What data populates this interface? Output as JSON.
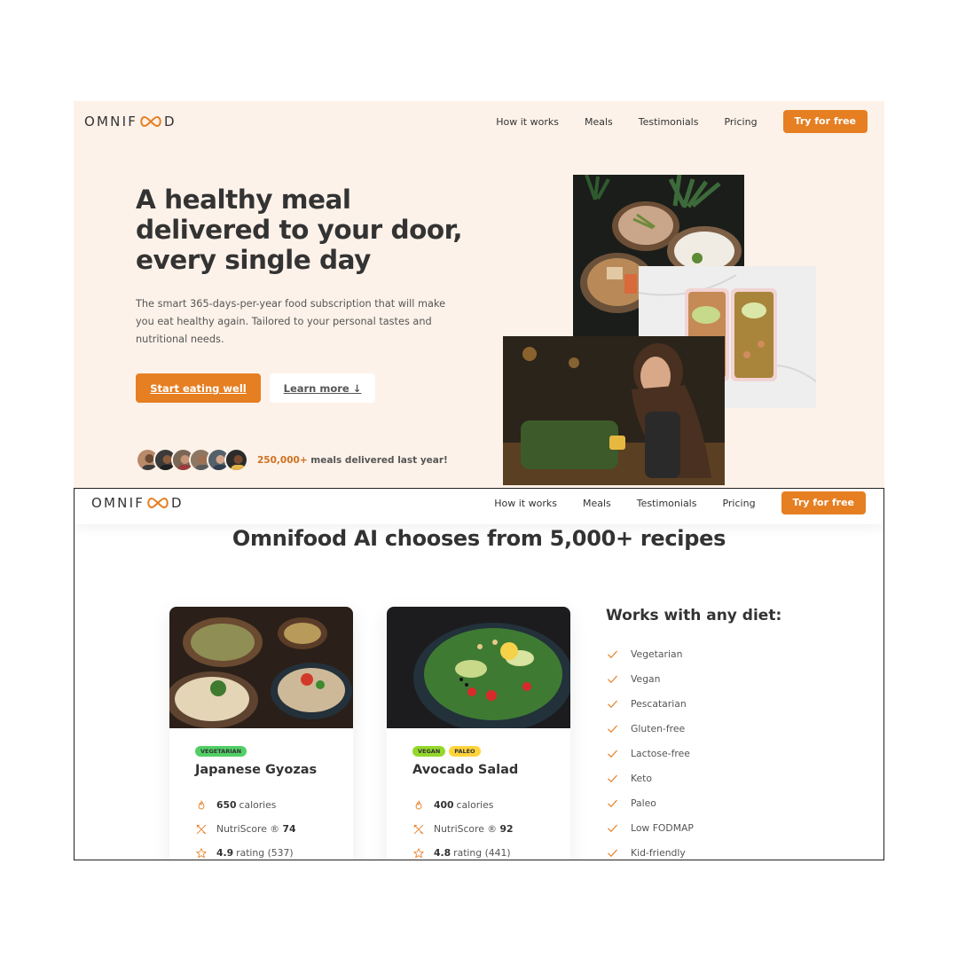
{
  "brand": {
    "logo_pre": "OMNIF",
    "logo_post": "D",
    "accent_color": "#e67e22",
    "hero_bg": "#fdf2e9"
  },
  "nav": {
    "items": [
      "How it works",
      "Meals",
      "Testimonials",
      "Pricing"
    ],
    "cta": "Try for free"
  },
  "hero": {
    "title": "A healthy meal delivered to your door, every single day",
    "description": "The smart 365-days-per-year food subscription that will make you eat healthy again. Tailored to your personal tastes and nutritional needs.",
    "primary_button": "Start eating well",
    "secondary_button": "Learn more ↓",
    "delivered_count": "250,000+",
    "delivered_text": "meals delivered last year!"
  },
  "meals_section": {
    "title": "Omnifood AI chooses from 5,000+ recipes",
    "meals": [
      {
        "tags": [
          "Vegetarian"
        ],
        "name": "Japanese Gyozas",
        "calories_value": "650",
        "calories_label": "calories",
        "nutri_label": "NutriScore ®",
        "nutri_value": "74",
        "rating_value": "4.9",
        "rating_label": "rating",
        "rating_count": "(537)"
      },
      {
        "tags": [
          "Vegan",
          "Paleo"
        ],
        "name": "Avocado Salad",
        "calories_value": "400",
        "calories_label": "calories",
        "nutri_label": "NutriScore ®",
        "nutri_value": "92",
        "rating_value": "4.8",
        "rating_label": "rating",
        "rating_count": "(441)"
      }
    ],
    "diets": {
      "title": "Works with any diet:",
      "items": [
        "Vegetarian",
        "Vegan",
        "Pescatarian",
        "Gluten-free",
        "Lactose-free",
        "Keto",
        "Paleo",
        "Low FODMAP",
        "Kid-friendly"
      ]
    }
  },
  "icons": {
    "calories": "flame-icon",
    "nutriscore": "restaurant-icon",
    "rating": "star-icon",
    "diet_item": "checkmark-icon"
  }
}
